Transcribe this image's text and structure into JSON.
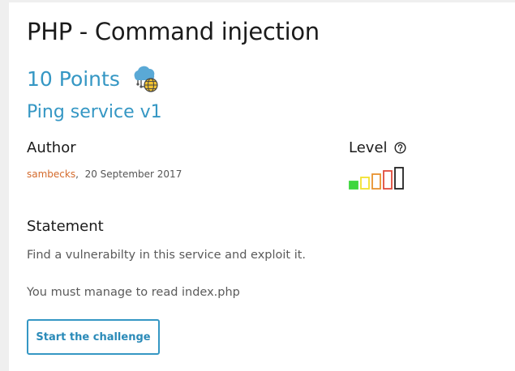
{
  "challenge": {
    "title": "PHP - Command injection",
    "points": "10 Points",
    "category_icon": "web-server-icon",
    "subtitle": "Ping service v1"
  },
  "author": {
    "label": "Author",
    "name": "sambecks",
    "separator": ",",
    "date": "20 September 2017"
  },
  "level": {
    "label": "Level",
    "help_icon": "question-circle-icon",
    "value": 1,
    "max": 5,
    "colors": [
      "#3dd63d",
      "#f2e12e",
      "#e8922e",
      "#e04b3a",
      "#222222"
    ]
  },
  "statement": {
    "label": "Statement",
    "lines": [
      "Find a vulnerabilty in this service and exploit it.",
      "You must manage to read index.php"
    ]
  },
  "actions": {
    "start_label": "Start the challenge"
  }
}
